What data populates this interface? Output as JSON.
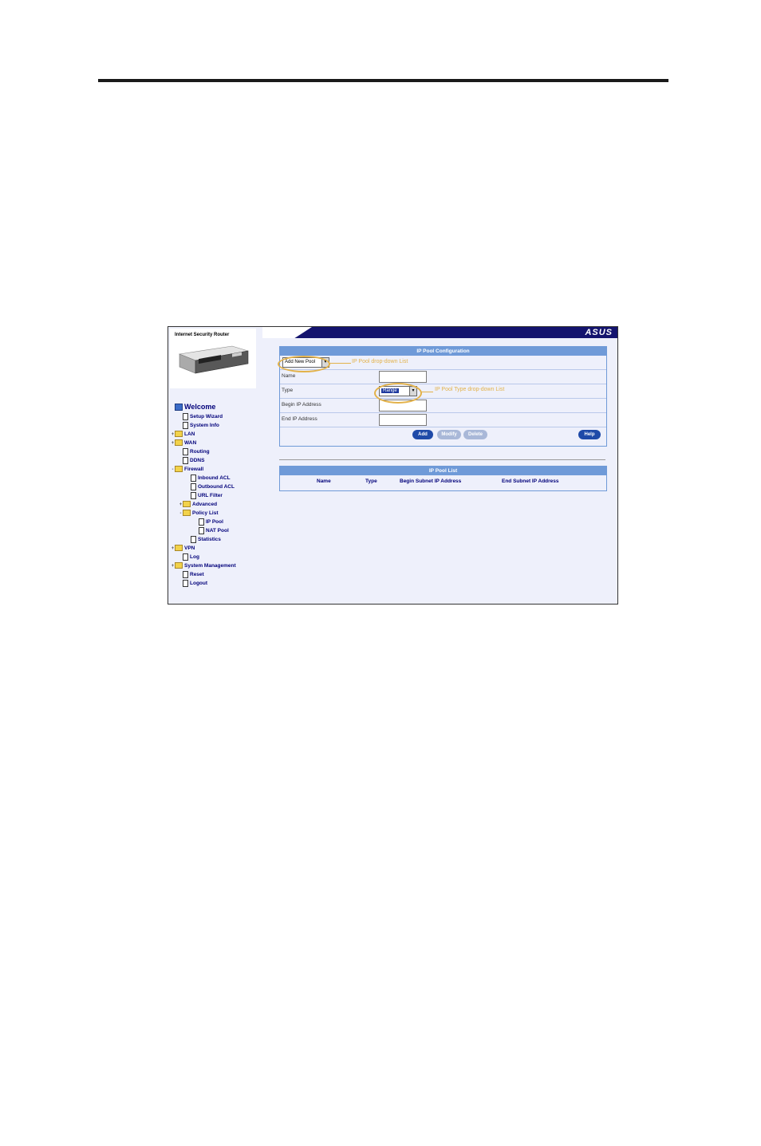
{
  "app": {
    "product_title": "Internet Security Router",
    "brand_logo": "ASUS"
  },
  "nav": {
    "items": [
      {
        "label": "Welcome",
        "icon": "monitor-icon",
        "toggle": ""
      },
      {
        "label": "Setup Wizard",
        "icon": "page-icon",
        "toggle": ""
      },
      {
        "label": "System Info",
        "icon": "page-icon",
        "toggle": ""
      },
      {
        "label": "LAN",
        "icon": "folder-icon",
        "toggle": "+"
      },
      {
        "label": "WAN",
        "icon": "folder-icon",
        "toggle": "+"
      },
      {
        "label": "Routing",
        "icon": "page-icon",
        "toggle": ""
      },
      {
        "label": "DDNS",
        "icon": "page-icon",
        "toggle": ""
      },
      {
        "label": "Firewall",
        "icon": "folder-icon",
        "toggle": "-"
      },
      {
        "label": "Inbound ACL",
        "icon": "page-icon",
        "toggle": ""
      },
      {
        "label": "Outbound ACL",
        "icon": "page-icon",
        "toggle": ""
      },
      {
        "label": "URL Filter",
        "icon": "page-icon",
        "toggle": ""
      },
      {
        "label": "Advanced",
        "icon": "folder-icon",
        "toggle": "+"
      },
      {
        "label": "Policy List",
        "icon": "folder-icon",
        "toggle": "-"
      },
      {
        "label": "IP Pool",
        "icon": "page-icon",
        "toggle": ""
      },
      {
        "label": "NAT Pool",
        "icon": "page-icon",
        "toggle": ""
      },
      {
        "label": "Statistics",
        "icon": "page-icon",
        "toggle": ""
      },
      {
        "label": "VPN",
        "icon": "folder-icon",
        "toggle": "+"
      },
      {
        "label": "Log",
        "icon": "page-icon",
        "toggle": ""
      },
      {
        "label": "System Management",
        "icon": "folder-icon",
        "toggle": "+"
      },
      {
        "label": "Reset",
        "icon": "page-icon",
        "toggle": ""
      },
      {
        "label": "Logout",
        "icon": "page-icon",
        "toggle": ""
      }
    ]
  },
  "config": {
    "header": "IP Pool Configuration",
    "pool_select_value": "Add New Pool",
    "pool_callout": "IP Pool drop-down List",
    "name_label": "Name",
    "type_label": "Type",
    "type_select_value": "Range",
    "type_callout": "IP Pool Type drop-down List",
    "begin_label": "Begin IP Address",
    "end_label": "End IP Address",
    "buttons": {
      "add": "Add",
      "modify": "Modify",
      "delete": "Delete",
      "help": "Help"
    }
  },
  "list": {
    "header": "IP Pool List",
    "columns": [
      "Name",
      "Type",
      "Begin Subnet IP Address",
      "End Subnet IP Address"
    ]
  },
  "colors": {
    "accent_blue": "#6f9ad8",
    "banner_navy": "#14146e",
    "callout": "#e3b24a"
  }
}
